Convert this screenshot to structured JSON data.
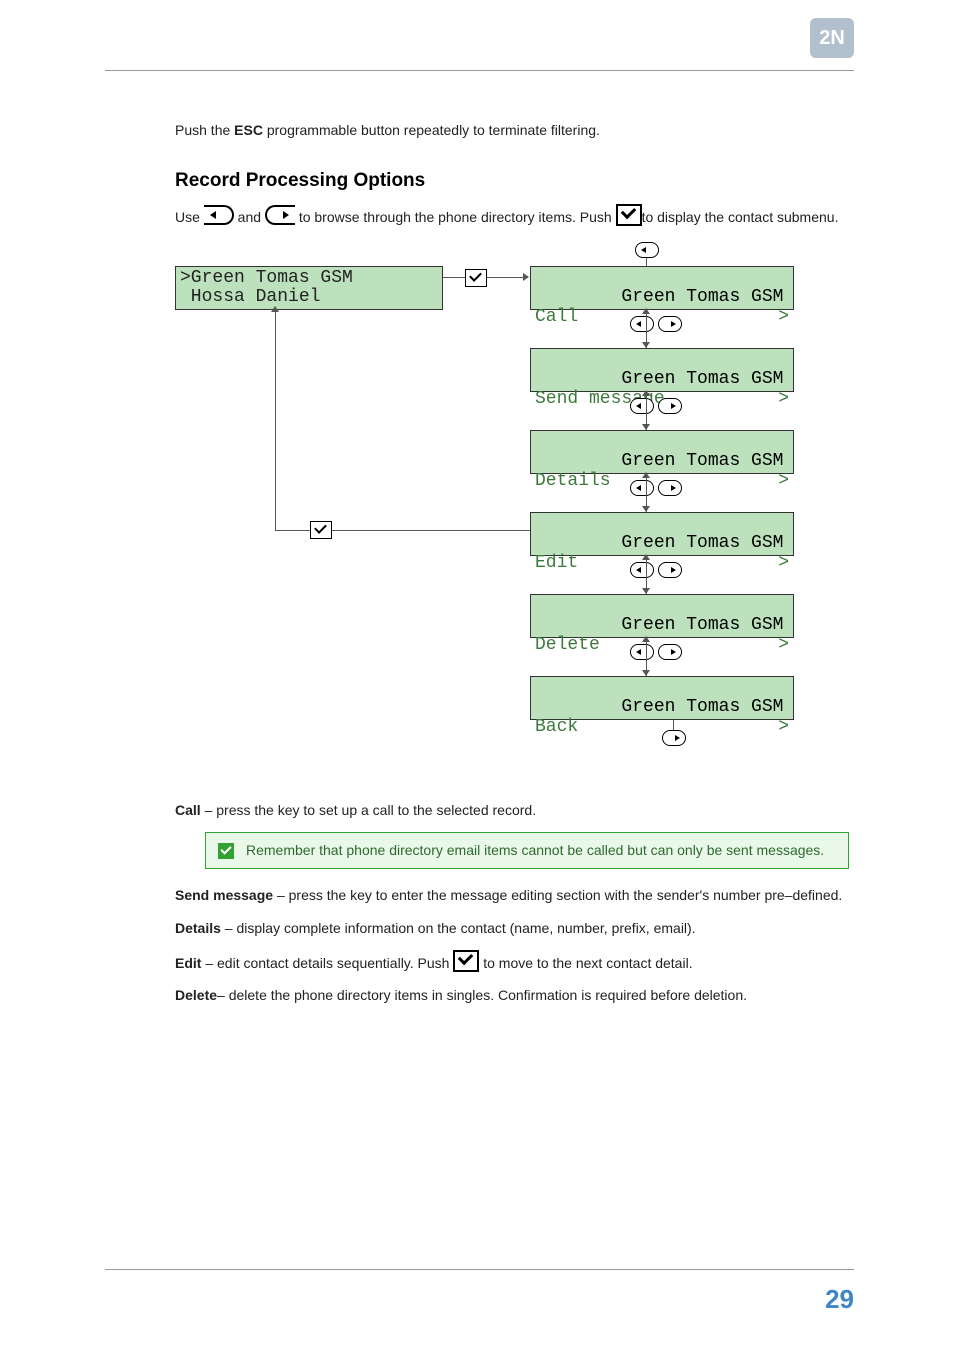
{
  "intro": "Push the ESC programmable button repeatedly to terminate filtering.",
  "intro_pre": "Push the ",
  "intro_esc": "ESC",
  "intro_post": " programmable button repeatedly to terminate filtering.",
  "heading": "Record Processing Options",
  "use1": "Use ",
  "use2": " and ",
  "use3": " to browse through the phone directory items. Push ",
  "use4": "to display the contact submenu.",
  "lcd_left_l1": ">Green Tomas GSM",
  "lcd_left_l2": " Hossa Daniel",
  "menu_items": [
    {
      "title": "Green Tomas GSM",
      "action": "Call"
    },
    {
      "title": "Green Tomas GSM",
      "action": "Send message"
    },
    {
      "title": "Green Tomas GSM",
      "action": "Details"
    },
    {
      "title": "Green Tomas GSM",
      "action": "Edit"
    },
    {
      "title": "Green Tomas GSM",
      "action": "Delete"
    },
    {
      "title": "Green Tomas GSM",
      "action": "Back"
    }
  ],
  "call_b": "Call",
  "call_t": " – press the key to set up a call to the selected record.",
  "note": "Remember that phone directory email items cannot be called but can only be sent messages.",
  "send_b": "Send message",
  "send_t": " – press the key to enter the message editing section with the sender's number pre–defined.",
  "details_b": "Details",
  "details_t": " – display complete information on the contact (name, number, prefix, email).",
  "edit_b": "Edit",
  "edit_t1": " – edit contact details sequentially. Push ",
  "edit_t2": " to move to the next contact detail.",
  "delete_b": "Delete",
  "delete_t": "– delete the phone directory items in singles. Confirmation is required before deletion.",
  "page_no": "29"
}
